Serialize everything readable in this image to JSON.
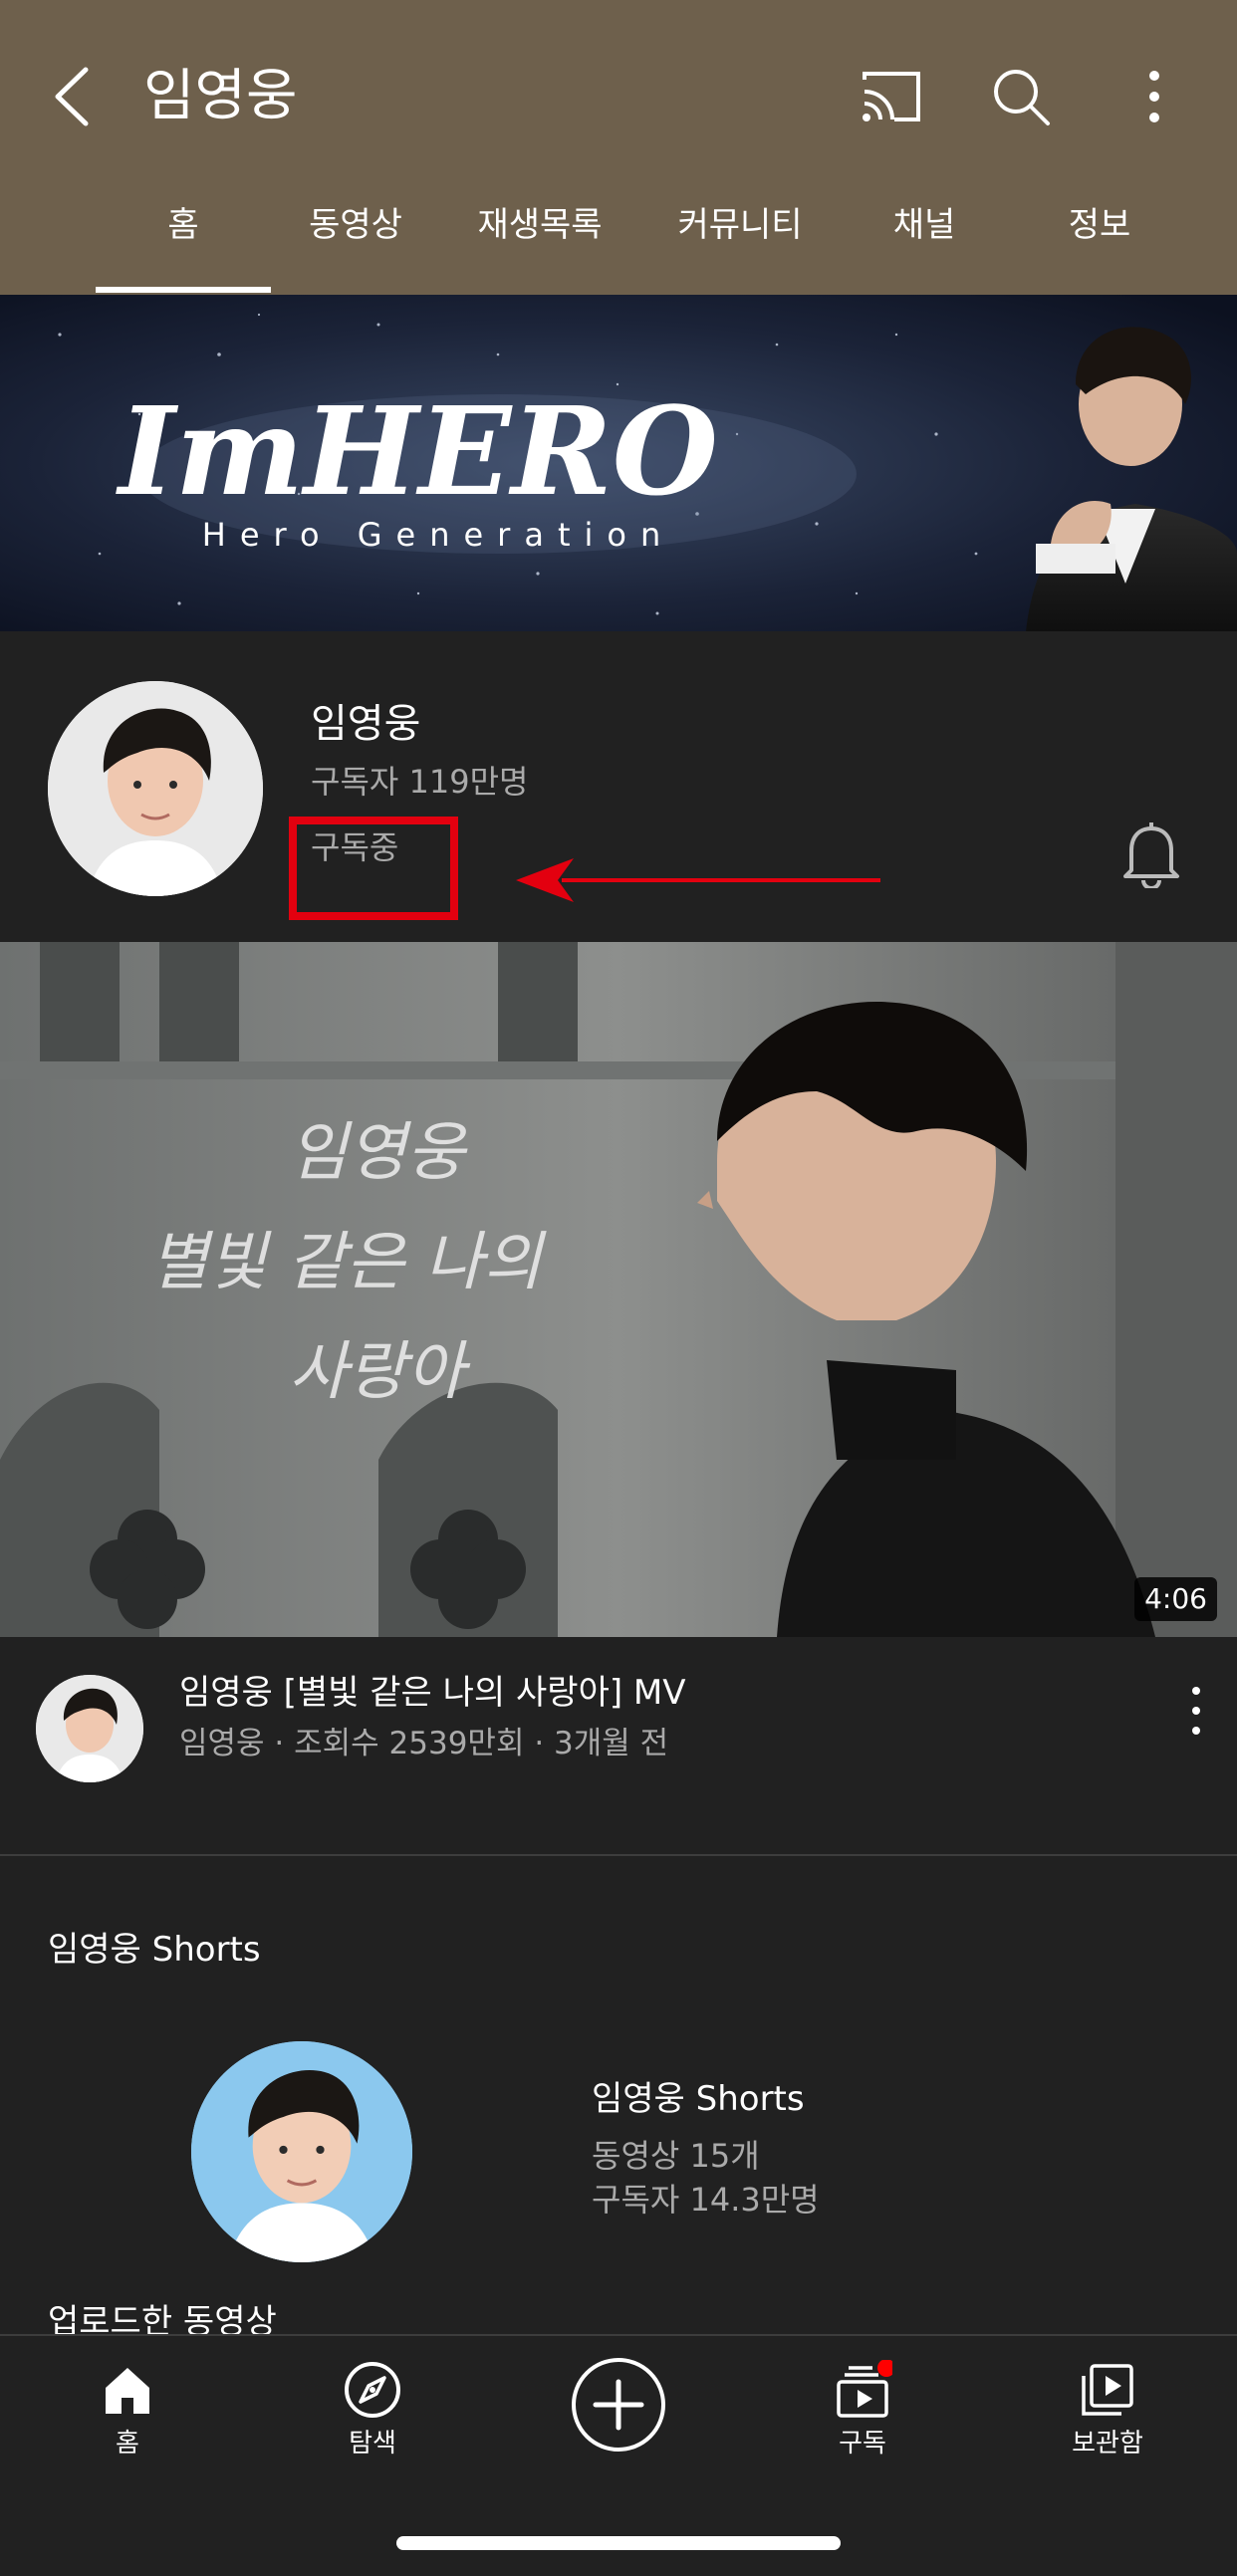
{
  "header": {
    "title": "임영웅",
    "tabs": [
      {
        "label": "홈",
        "active": true
      },
      {
        "label": "동영상"
      },
      {
        "label": "재생목록"
      },
      {
        "label": "커뮤니티"
      },
      {
        "label": "채널"
      },
      {
        "label": "정보"
      }
    ],
    "icons": [
      "back-arrow-icon",
      "cast-icon",
      "search-icon",
      "more-vertical-icon"
    ]
  },
  "banner": {
    "logo_text": "ImHERO",
    "tagline": "Hero Generation"
  },
  "channel": {
    "name": "임영웅",
    "subscribers": "구독자 119만명",
    "subscribed_label": "구독중"
  },
  "video": {
    "duration": "4:06",
    "title": "임영웅 [별빛 같은 나의 사랑아] MV",
    "meta": "임영웅 · 조회수 2539만회 · 3개월 전",
    "thumbnail_text": [
      "임영웅",
      "별빛 같은 나의",
      "사랑아"
    ]
  },
  "shorts_section": {
    "title": "임영웅 Shorts",
    "channel_name": "임영웅 Shorts",
    "videos": "동영상 15개",
    "subscribers": "구독자 14.3만명"
  },
  "next_section": {
    "title": "업로드한 동영상"
  },
  "bottom_nav": {
    "items": [
      {
        "label": "홈",
        "icon": "home-icon"
      },
      {
        "label": "탐색",
        "icon": "compass-icon"
      },
      {
        "label": "",
        "icon": "create-plus-icon"
      },
      {
        "label": "구독",
        "icon": "subscriptions-icon"
      },
      {
        "label": "보관함",
        "icon": "library-icon"
      }
    ]
  },
  "colors": {
    "header_bg": "#6e604c",
    "page_bg": "#212121",
    "highlight_red": "#e3000f",
    "notification_dot": "#ff0000"
  }
}
